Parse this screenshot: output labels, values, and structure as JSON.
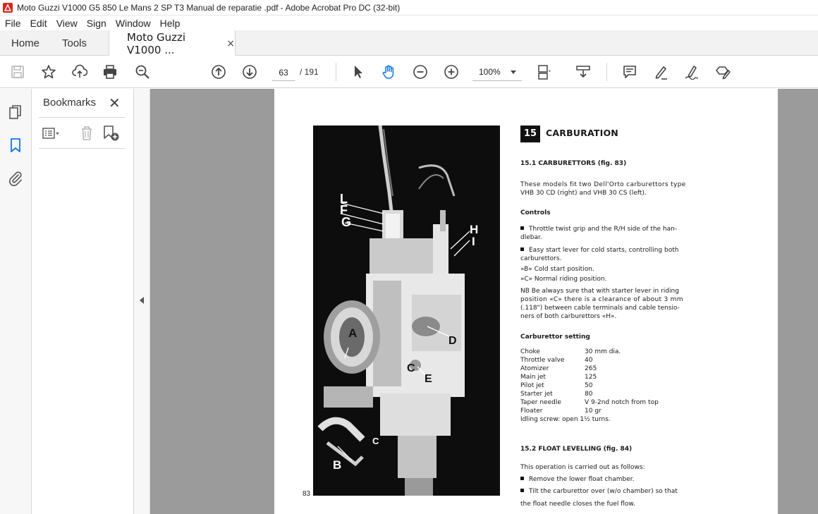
{
  "window": {
    "title": "Moto Guzzi V1000 G5 850 Le Mans 2 SP T3 Manual de reparatie .pdf - Adobe Acrobat Pro DC (32-bit)"
  },
  "menu": [
    "File",
    "Edit",
    "View",
    "Sign",
    "Window",
    "Help"
  ],
  "tabs": {
    "home": "Home",
    "tools": "Tools",
    "document": "Moto Guzzi V1000 ...",
    "close": "×"
  },
  "toolbar": {
    "current_page": "63",
    "total_pages": "/ 191",
    "zoom": "100%"
  },
  "bookmarks": {
    "title": "Bookmarks",
    "close": "✕"
  },
  "document": {
    "page_number": "83",
    "figure_labels": [
      "L",
      "F",
      "G",
      "H",
      "I",
      "A",
      "D",
      "C",
      "E",
      "B",
      "C"
    ],
    "section_number": "15",
    "section_title": "CARBURATION",
    "sub1_title": "15.1   CARBURETTORS (fig. 83)",
    "sub1_text": [
      "These models fit two Dell'Orto carburettors type",
      "VHB 30 CD (right) and VHB 30 CS (left)."
    ],
    "controls_heading": "Controls",
    "controls": [
      "Throttle twist grip and the R/H side of the han-",
      "dlebar.",
      "Easy start lever for cold starts, controlling both",
      "carburettors.",
      "»B»   Cold start position.",
      "»C»   Normal riding position."
    ],
    "nb_text": [
      "NB  Be always sure that with starter lever in riding",
      "position «C» there is a clearance of about 3 mm",
      "(.118\") between cable terminals and cable tensio-",
      "ners of both carburettors «H»."
    ],
    "setting_heading": "Carburettor setting",
    "settings": [
      {
        "k": "Choke",
        "v": "30 mm dia."
      },
      {
        "k": "Throttle valve",
        "v": "40"
      },
      {
        "k": "Atomizer",
        "v": "265"
      },
      {
        "k": "Main jet",
        "v": "125"
      },
      {
        "k": "Pilot jet",
        "v": "50"
      },
      {
        "k": "Starter jet",
        "v": "80"
      },
      {
        "k": "Taper needle",
        "v": "V 9-2nd notch from top"
      },
      {
        "k": "Floater",
        "v": "10 gr"
      }
    ],
    "idling": "Idling screw: open 1½ turns.",
    "sub2_title": "15.2   FLOAT LEVELLING (fig. 84)",
    "sub2_text": [
      "This operation is carried out as follows:",
      "Remove the lower float chamber.",
      "Tilt the carburettor over (w/o chamber) so that",
      "the float needle closes the fuel flow."
    ]
  },
  "colors": {
    "accent": "#1473e6",
    "toolbar_bg": "#ffffff",
    "viewer_bg": "#9b9b9b"
  }
}
